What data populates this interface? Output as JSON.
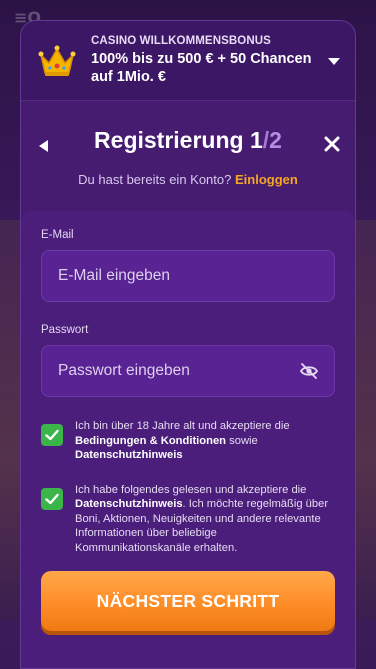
{
  "bonus": {
    "kicker": "CASINO WILLKOMMENSBONUS",
    "title": "100% bis zu 500 € + 50 Chancen auf 1Mio. €",
    "crown_icon": "crown-icon",
    "chevron_icon": "chevron-down-icon"
  },
  "header": {
    "title": "Registrierung",
    "step_current": "1",
    "step_separator": "/",
    "step_total": "2",
    "login_prompt": "Du hast bereits ein Konto?",
    "login_link": "Einloggen"
  },
  "form": {
    "email_label": "E-Mail",
    "email_placeholder": "E-Mail eingeben",
    "email_value": "",
    "password_label": "Passwort",
    "password_placeholder": "Passwort eingeben",
    "password_value": ""
  },
  "consents": [
    {
      "checked": true,
      "pre": "Ich bin über 18 Jahre alt und akzeptiere die ",
      "bold1": "Bedingungen & Konditionen",
      "mid": " sowie ",
      "bold2": "Datenschutzhinweis",
      "post": ""
    },
    {
      "checked": true,
      "pre": "Ich habe folgendes gelesen und akzeptiere die ",
      "bold1": "Datenschutzhinweis",
      "mid": ". Ich möchte regelmäßig über Boni, Aktionen, Neuigkeiten und andere relevante Informationen über beliebige Kommunikationskanäle erhalten.",
      "bold2": "",
      "post": ""
    }
  ],
  "cta": {
    "label": "NÄCHSTER SCHRITT"
  },
  "colors": {
    "accent": "#f6a623",
    "checkbox": "#3bb54a",
    "modal_bg": "#451c70",
    "button": "#ff8f2a"
  }
}
